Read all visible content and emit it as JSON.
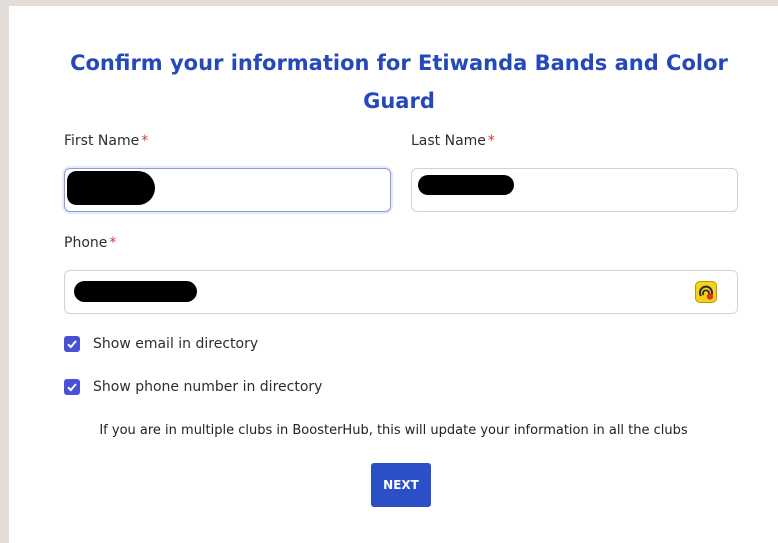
{
  "form": {
    "title": "Confirm your information for Etiwanda Bands and Color Guard",
    "first_name_label": "First Name",
    "last_name_label": "Last Name",
    "phone_label": "Phone",
    "required_marker": "*",
    "show_email_label": "Show email in directory",
    "show_email_checked": true,
    "show_phone_label": "Show phone number in directory",
    "show_phone_checked": true,
    "note": "If you are in multiple clubs in BoosterHub, this will update your information in all the clubs",
    "next_label": "NEXT"
  },
  "colors": {
    "title": "#2549b8",
    "button": "#2b4fc7",
    "checkbox": "#4a4fd8",
    "required": "#d33a2c"
  },
  "icons": {
    "phone_field_extension": "password-manager-icon",
    "checkbox_mark": "checkmark-icon"
  }
}
